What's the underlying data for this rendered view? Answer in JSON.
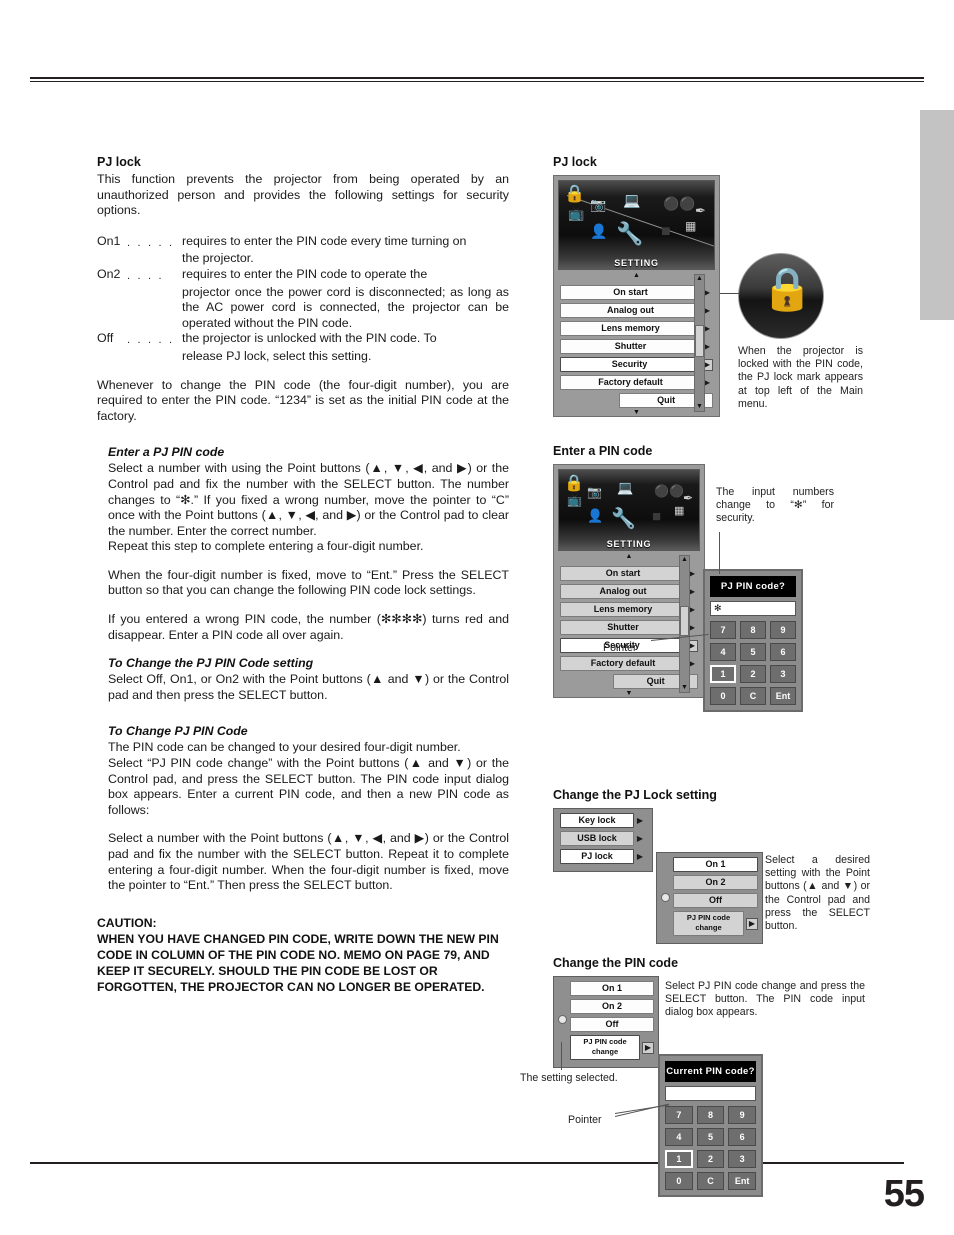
{
  "page": {
    "number": "55"
  },
  "left": {
    "heading": "PJ lock",
    "intro": "This function prevents the projector from being operated by an unauthorized person and provides the following settings for security options.",
    "definitions": [
      {
        "term": "On1",
        "dots": ". . . . .",
        "text": "requires to enter the PIN code every time turning on",
        "cont": "the projector."
      },
      {
        "term": "On2",
        "dots": ". . . .",
        "text": "requires to enter the PIN code to operate the",
        "cont": "projector once the power cord is disconnected; as long as the AC power cord is connected, the projector can be operated without the PIN code."
      },
      {
        "term": "Off",
        "dots": ". . . . .",
        "text": "the projector is unlocked with the PIN code. To",
        "cont": "release PJ lock, select this setting."
      }
    ],
    "whenever": "Whenever to change the PIN code (the four-digit number), you are required to enter the PIN code. “1234” is set as the initial PIN code at the factory.",
    "enter_pin_heading": "Enter a PJ PIN code",
    "enter_pin_p1": "Select a number with using the Point buttons (▲, ▼, ◀, and ▶) or the Control pad and fix the number with the SELECT button. The number changes to “✻.” If you fixed a wrong number, move the pointer to “C” once with the Point buttons (▲, ▼, ◀, and ▶) or the Control pad to clear the number. Enter the correct number.",
    "enter_pin_p2": "Repeat this step to complete entering a four-digit number.",
    "enter_pin_p3": "When the four-digit number is fixed, move to “Ent.”  Press the SELECT button so that you can change the following PIN code lock settings.",
    "enter_pin_p4": "If you entered a wrong PIN code, the number (✻✻✻✻) turns red and disappear. Enter a PIN code all over again.",
    "change_setting_heading": "To Change the PJ PIN Code setting",
    "change_setting_p1": "Select Off, On1, or On2 with the Point buttons (▲ and ▼) or the Control pad and then press the SELECT button.",
    "change_code_heading": "To Change PJ PIN Code",
    "change_code_p1": "The PIN code can be changed to your desired four-digit number.",
    "change_code_p2": "Select “PJ PIN code change” with the Point buttons (▲ and ▼) or the Control pad, and press the SELECT button. The PIN code input dialog box appears. Enter a current PIN code, and then a new PIN code as follows:",
    "change_code_p3": "Select a number with the Point buttons (▲, ▼, ◀, and ▶) or the Control pad and fix the number with the SELECT button. Repeat it to complete entering a four-digit number. When the four-digit number is fixed, move the pointer to “Ent.”  Then press the SELECT button.",
    "caution_title": "CAUTION:",
    "caution_body": "WHEN YOU HAVE CHANGED PIN CODE, WRITE DOWN THE NEW PIN CODE IN COLUMN OF THE PIN CODE NO. MEMO ON PAGE 79, AND KEEP IT SECURELY.  SHOULD THE PIN CODE BE LOST OR FORGOTTEN, THE PROJECTOR CAN NO LONGER BE OPERATED."
  },
  "right": {
    "fig1": {
      "heading": "PJ lock",
      "osd_title": "SETTING",
      "menu_items": [
        {
          "label": "On start",
          "selected": false
        },
        {
          "label": "Analog out",
          "selected": false
        },
        {
          "label": "Lens memory",
          "selected": false
        },
        {
          "label": "Shutter",
          "selected": false
        },
        {
          "label": "Security",
          "selected": true
        },
        {
          "label": "Factory default",
          "selected": false
        }
      ],
      "quit_label": "Quit",
      "callout": "When the projector is locked with the PIN code, the PJ lock mark appears at top left of the Main menu.",
      "lock_icon": "lock-icon"
    },
    "fig2": {
      "heading": "Enter a PIN code",
      "osd_title": "SETTING",
      "menu_items": [
        {
          "label": "On start",
          "selected": false
        },
        {
          "label": "Analog out",
          "selected": false
        },
        {
          "label": "Lens memory",
          "selected": false
        },
        {
          "label": "Shutter",
          "selected": false
        },
        {
          "label": "Security",
          "selected": true
        },
        {
          "label": "Factory default",
          "selected": false
        }
      ],
      "quit_label": "Quit",
      "note": "The input numbers change to “✻” for security.",
      "pointer_label": "Pointer",
      "dialog": {
        "title": "PJ PIN code?",
        "input_value": "✻",
        "keys": [
          "7",
          "8",
          "9",
          "4",
          "5",
          "6",
          "1",
          "2",
          "3",
          "0",
          "C",
          "Ent"
        ],
        "highlighted_key": "1"
      }
    },
    "fig3": {
      "heading": "Change the PJ Lock setting",
      "menu_items": [
        {
          "label": "Key lock",
          "selected": true
        },
        {
          "label": "USB lock",
          "selected": false
        },
        {
          "label": "PJ lock",
          "selected": true
        }
      ],
      "submenu_items": [
        {
          "label": "On 1",
          "selected": true
        },
        {
          "label": "On 2",
          "selected": false
        },
        {
          "label": "Off",
          "selected": false
        },
        {
          "label": "PJ PIN code change",
          "selected": false
        }
      ],
      "note": "Select a desired setting with the Point buttons (▲ and ▼) or the Control pad and press the SELECT button."
    },
    "fig4": {
      "heading": "Change the PIN code",
      "submenu_items": [
        {
          "label": "On 1",
          "selected": true
        },
        {
          "label": "On 2",
          "selected": true
        },
        {
          "label": "Off",
          "selected": true
        },
        {
          "label": "PJ PIN code change",
          "selected": true
        }
      ],
      "note": "Select PJ PIN code change and press the SELECT button. The PIN code input dialog box appears.",
      "setting_selected_label": "The setting selected.",
      "pointer_label": "Pointer",
      "dialog": {
        "title": "Current PIN code?",
        "input_value": "",
        "keys": [
          "7",
          "8",
          "9",
          "4",
          "5",
          "6",
          "1",
          "2",
          "3",
          "0",
          "C",
          "Ent"
        ],
        "highlighted_key": "1"
      }
    }
  }
}
